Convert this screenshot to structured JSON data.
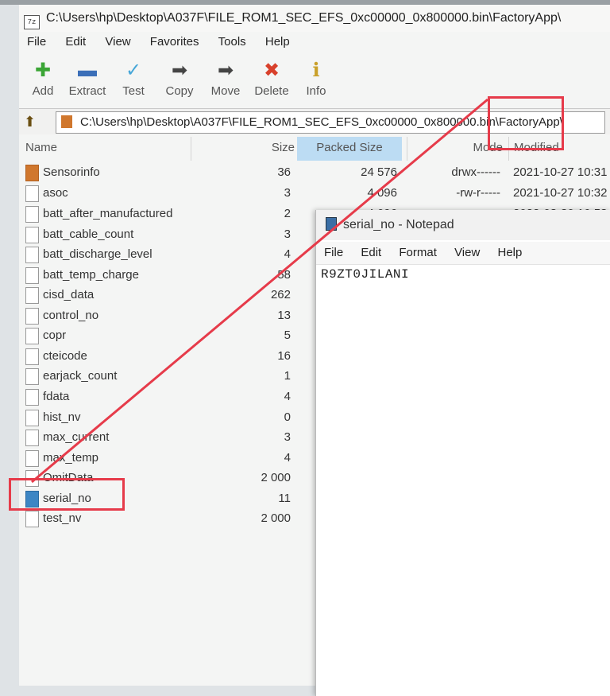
{
  "window": {
    "title": "C:\\Users\\hp\\Desktop\\A037F\\FILE_ROM1_SEC_EFS_0xc00000_0x800000.bin\\FactoryApp\\",
    "app_icon": "7z"
  },
  "menu": [
    "File",
    "Edit",
    "View",
    "Favorites",
    "Tools",
    "Help"
  ],
  "toolbar": [
    {
      "label": "Add",
      "icon": "plus-icon",
      "color": "#3aa535"
    },
    {
      "label": "Extract",
      "icon": "minus-icon",
      "color": "#3b6fb8"
    },
    {
      "label": "Test",
      "icon": "check-icon",
      "color": "#47a7d8"
    },
    {
      "label": "Copy",
      "icon": "arrow-right-icon",
      "color": "#444444"
    },
    {
      "label": "Move",
      "icon": "arrow-right-icon",
      "color": "#444444"
    },
    {
      "label": "Delete",
      "icon": "close-icon",
      "color": "#d8402b"
    },
    {
      "label": "Info",
      "icon": "info-icon",
      "color": "#c9a02a"
    }
  ],
  "address": "C:\\Users\\hp\\Desktop\\A037F\\FILE_ROM1_SEC_EFS_0xc00000_0x800000.bin\\FactoryApp\\",
  "columns": {
    "name": "Name",
    "size": "Size",
    "packed": "Packed Size",
    "mode": "Mode",
    "modified": "Modified"
  },
  "files": [
    {
      "name": "Sensorinfo",
      "size": "36",
      "packed": "24 576",
      "mode": "drwx------",
      "modified": "2021-10-27 10:31",
      "type": "folder"
    },
    {
      "name": "asoc",
      "size": "3",
      "packed": "4 096",
      "mode": "-rw-r-----",
      "modified": "2021-10-27 10:32",
      "type": "file"
    },
    {
      "name": "batt_after_manufactured",
      "size": "2",
      "packed": "4 096",
      "mode": "",
      "modified": "2022-08-30 10:53",
      "type": "file"
    },
    {
      "name": "batt_cable_count",
      "size": "3",
      "packed": "",
      "mode": "",
      "modified": "",
      "type": "file"
    },
    {
      "name": "batt_discharge_level",
      "size": "4",
      "packed": "",
      "mode": "",
      "modified": "",
      "type": "file"
    },
    {
      "name": "batt_temp_charge",
      "size": "58",
      "packed": "",
      "mode": "",
      "modified": "",
      "type": "file"
    },
    {
      "name": "cisd_data",
      "size": "262",
      "packed": "",
      "mode": "",
      "modified": "",
      "type": "file"
    },
    {
      "name": "control_no",
      "size": "13",
      "packed": "",
      "mode": "",
      "modified": "",
      "type": "file"
    },
    {
      "name": "copr",
      "size": "5",
      "packed": "",
      "mode": "",
      "modified": "",
      "type": "file"
    },
    {
      "name": "cteicode",
      "size": "16",
      "packed": "",
      "mode": "",
      "modified": "",
      "type": "file"
    },
    {
      "name": "earjack_count",
      "size": "1",
      "packed": "",
      "mode": "",
      "modified": "",
      "type": "file"
    },
    {
      "name": "fdata",
      "size": "4",
      "packed": "",
      "mode": "",
      "modified": "",
      "type": "file"
    },
    {
      "name": "hist_nv",
      "size": "0",
      "packed": "",
      "mode": "",
      "modified": "",
      "type": "file"
    },
    {
      "name": "max_current",
      "size": "3",
      "packed": "",
      "mode": "",
      "modified": "",
      "type": "file"
    },
    {
      "name": "max_temp",
      "size": "4",
      "packed": "",
      "mode": "",
      "modified": "",
      "type": "file"
    },
    {
      "name": "OmitData",
      "size": "2 000",
      "packed": "",
      "mode": "",
      "modified": "",
      "type": "file"
    },
    {
      "name": "serial_no",
      "size": "11",
      "packed": "",
      "mode": "",
      "modified": "",
      "type": "selected"
    },
    {
      "name": "test_nv",
      "size": "2 000",
      "packed": "",
      "mode": "",
      "modified": "",
      "type": "file"
    }
  ],
  "notepad": {
    "title": "serial_no - Notepad",
    "menu": [
      "File",
      "Edit",
      "Format",
      "View",
      "Help"
    ],
    "content": "R9ZT0JILANI"
  },
  "annotation_color": "#e63b4a"
}
